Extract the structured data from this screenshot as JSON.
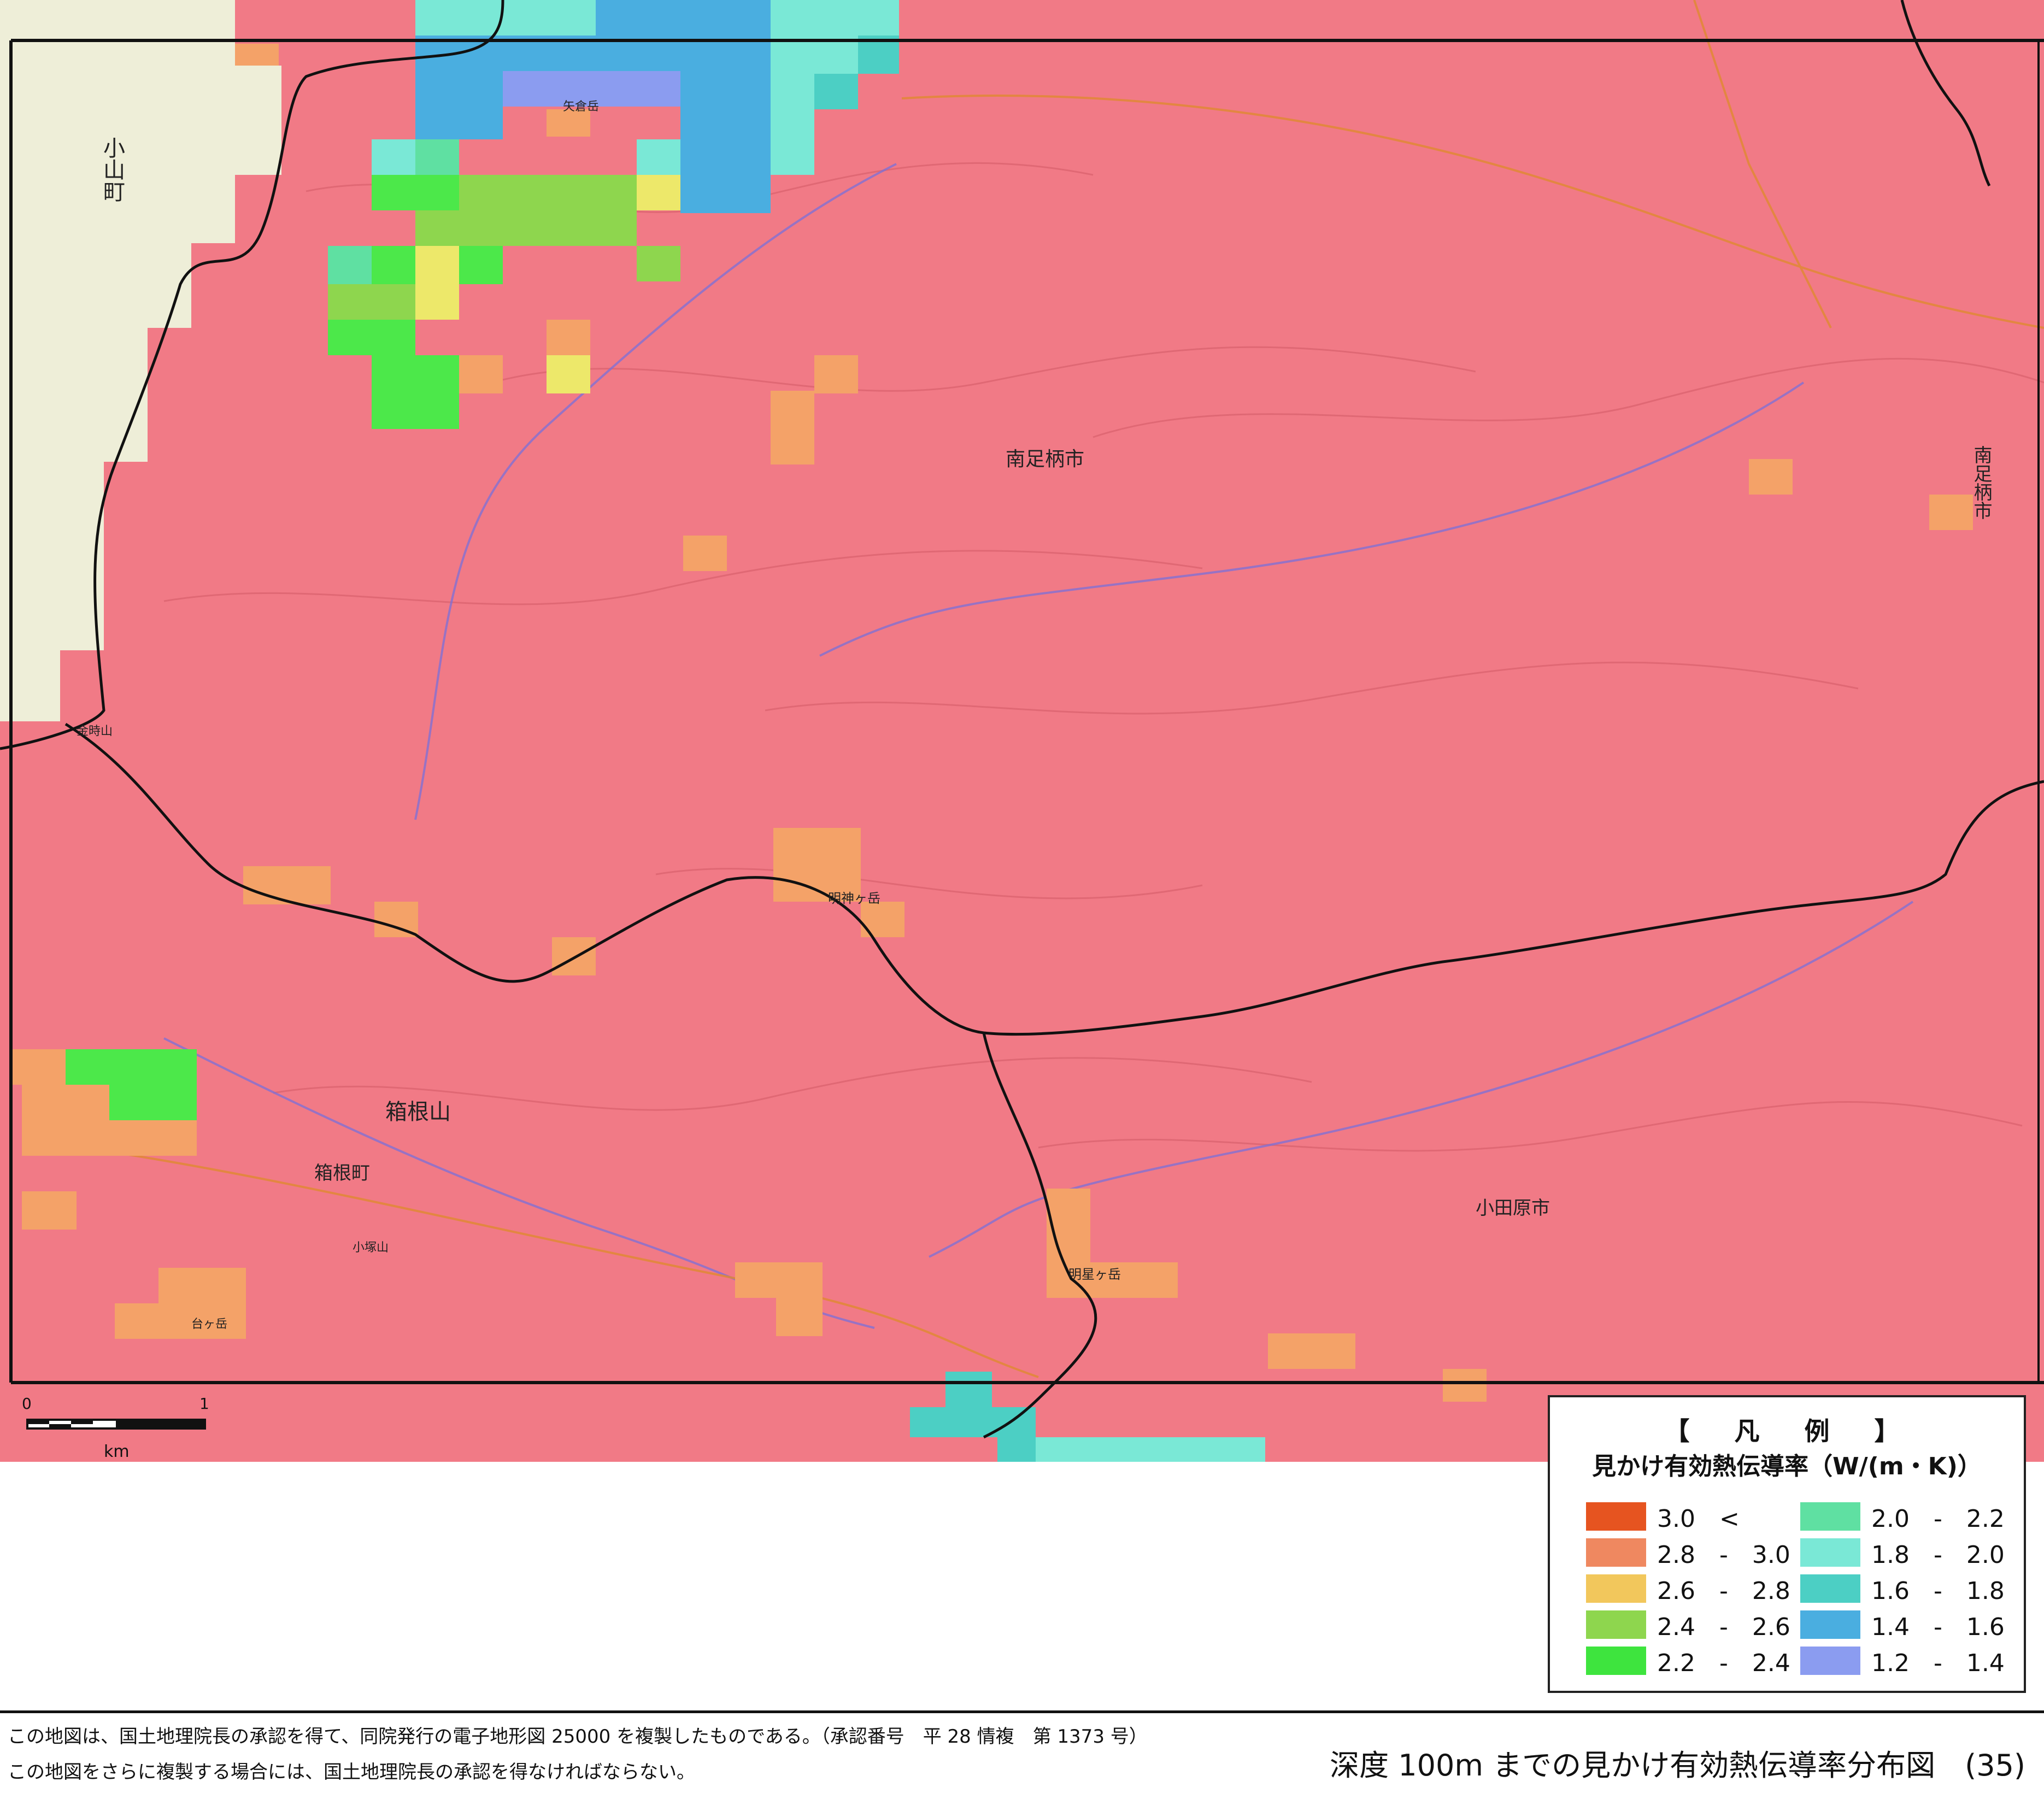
{
  "map": {
    "place_names": {
      "oyama_town": "小山町",
      "minamiashigara_city": "南足柄市",
      "minamiashigara_city_edge": "南足柄市",
      "hakone_mountain": "箱根山",
      "hakone_town": "箱根町",
      "odawara_city": "小田原市"
    },
    "peaks": {
      "yagura": "矢倉岳",
      "myojin": "明神ヶ岳",
      "myojo": "明星ヶ岳",
      "daigatake": "台ヶ岳",
      "kintoki": "金時山",
      "kozuka": "小塚山"
    },
    "scale_bar": {
      "start_label": "0",
      "end_label": "1",
      "unit_label": "km"
    },
    "colors": {
      "base_overlay": "#f17a86",
      "oyama_background": "#eeeed8",
      "boundary_line": "#111111"
    }
  },
  "legend": {
    "title": "【　凡　例　】",
    "subtitle": "見かけ有効熱伝導率（W/(m・K)）",
    "items": [
      {
        "label": "3.0　<",
        "color": "#e65420"
      },
      {
        "label": "2.8　-　3.0",
        "color": "#ef8860"
      },
      {
        "label": "2.6　-　2.8",
        "color": "#f2c75c"
      },
      {
        "label": "2.4　-　2.6",
        "color": "#8ed64e"
      },
      {
        "label": "2.2　-　2.4",
        "color": "#3ee43e"
      },
      {
        "label": "2.0　-　2.2",
        "color": "#5fe0a2"
      },
      {
        "label": "1.8　-　2.0",
        "color": "#7ae8d6"
      },
      {
        "label": "1.6　-　1.8",
        "color": "#4ccfc4"
      },
      {
        "label": "1.4　-　1.6",
        "color": "#4aaee0"
      },
      {
        "label": "1.2　-　1.4",
        "color": "#8b9cf0"
      }
    ]
  },
  "footer": {
    "note_line1": "この地図は、国土地理院長の承認を得て、同院発行の電子地形図 25000 を複製したものである。（承認番号　平 28 情複　第 1373 号）",
    "note_line2": "この地図をさらに複製する場合には、国土地理院長の承認を得なければならない。",
    "figure_title": "深度 100m までの見かけ有効熱伝導率分布図　(35)"
  }
}
